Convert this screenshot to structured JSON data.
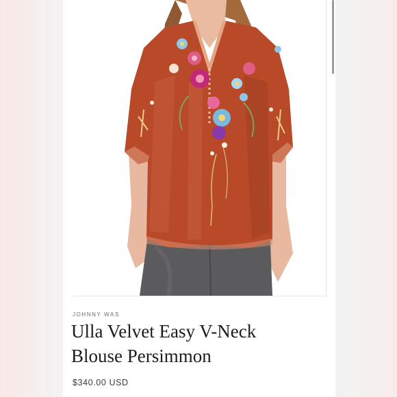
{
  "product": {
    "brand": "JOHNNY WAS",
    "title_line1": "Ulla Velvet Easy V-Neck",
    "title_line2": "Blouse Persimmon",
    "price": "$340.00 USD"
  },
  "colors": {
    "blouse": "#b84a2a",
    "jeans": "#5b5b5e",
    "skin": "#e8b9a0",
    "hair": "#a36a3c"
  }
}
